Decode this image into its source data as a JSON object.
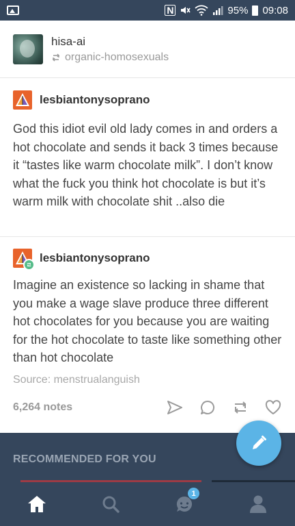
{
  "status_bar": {
    "battery": "95%",
    "time": "09:08",
    "icons": [
      "gallery-icon",
      "nfc-icon",
      "mute-icon",
      "wifi-icon",
      "signal-icon",
      "battery-icon"
    ]
  },
  "reblog_header": {
    "username": "hisa-ai",
    "reblogged_from": "organic-homosexuals"
  },
  "posts": [
    {
      "author": "lesbiantonysoprano",
      "body": "God this idiot evil old lady comes in and orders a hot chocolate and sends it back 3 times because it “tastes like warm chocolate milk”. I don’t know what the fuck you think hot chocolate is but it’s warm milk with chocolate shit ..also die"
    },
    {
      "author": "lesbiantonysoprano",
      "body": "Imagine an existence so lacking in shame that you make a wage slave produce three different hot chocolates for you because you are waiting for the hot chocolate to taste like something other than hot chocolate",
      "source": "Source: menstrualanguish",
      "notes": "6,264 notes"
    }
  ],
  "actions": [
    "share-icon",
    "reply-icon",
    "reblog-icon",
    "like-icon"
  ],
  "recommended": {
    "label": "RECOMMENDED FOR YOU"
  },
  "bottom_nav": {
    "items": [
      "home-icon",
      "search-icon",
      "activity-icon",
      "account-icon"
    ],
    "activity_badge": "1"
  },
  "colors": {
    "navy": "#35465c",
    "accent_blue": "#5bb4e6",
    "avatar_orange": "#e8632b",
    "reblog_green": "#56bc8a"
  }
}
